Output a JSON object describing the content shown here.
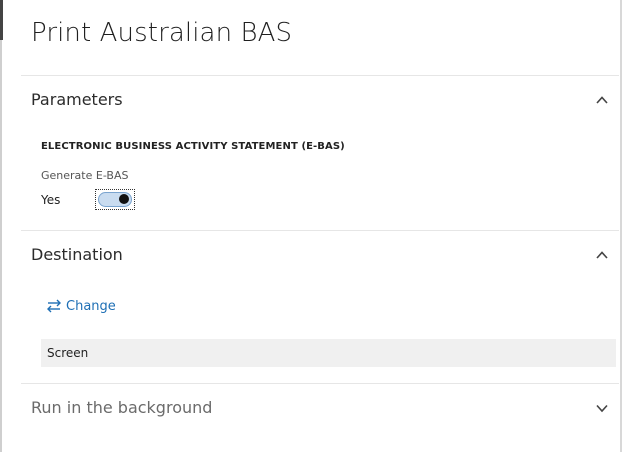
{
  "dialog": {
    "title": "Print Australian BAS"
  },
  "sections": {
    "parameters": {
      "title": "Parameters",
      "expanded": true,
      "chevron_icon": "chevron-up-icon",
      "group_label": "ELECTRONIC BUSINESS ACTIVITY STATEMENT (E-BAS)",
      "generate_ebas": {
        "label": "Generate E-BAS",
        "value_text": "Yes",
        "checked": true
      }
    },
    "destination": {
      "title": "Destination",
      "expanded": true,
      "chevron_icon": "chevron-up-icon",
      "change_label": "Change",
      "change_icon": "swap-arrows-icon",
      "value": "Screen"
    },
    "background": {
      "title": "Run in the background",
      "expanded": false,
      "chevron_icon": "chevron-down-icon"
    }
  },
  "colors": {
    "link": "#1e6fb5",
    "toggle_track": "#c9dcf0",
    "field_bg": "#f0f0f0"
  }
}
